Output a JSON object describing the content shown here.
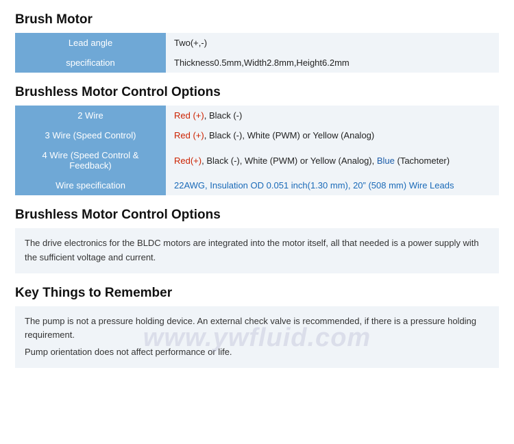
{
  "page": {
    "watermark": "www.ywfluid.com",
    "sections": [
      {
        "id": "brush-motor",
        "title": "Brush Motor",
        "type": "table",
        "rows": [
          {
            "label": "Lead angle",
            "value_parts": [
              {
                "text": "Two(+,-)",
                "color": "default"
              }
            ]
          },
          {
            "label": "specification",
            "value_parts": [
              {
                "text": "Thickness0.5mm,Width2.8mm,Height6.2mm",
                "color": "default"
              }
            ]
          }
        ]
      },
      {
        "id": "brushless-control-options",
        "title": "Brushless Motor Control Options",
        "type": "table",
        "rows": [
          {
            "label": "2 Wire",
            "value_parts": [
              {
                "text": "Red (+)",
                "color": "red"
              },
              {
                "text": ", ",
                "color": "default"
              },
              {
                "text": "Black (-)",
                "color": "black"
              }
            ]
          },
          {
            "label": "3 Wire (Speed Control)",
            "value_parts": [
              {
                "text": "Red (+)",
                "color": "red"
              },
              {
                "text": ", ",
                "color": "default"
              },
              {
                "text": "Black (-)",
                "color": "black"
              },
              {
                "text": ", White (PWM) or Yellow (Analog)",
                "color": "default"
              }
            ]
          },
          {
            "label": "4 Wire (Speed Control & Feedback)",
            "value_parts": [
              {
                "text": "Red(+)",
                "color": "red"
              },
              {
                "text": ", ",
                "color": "default"
              },
              {
                "text": "Black (-)",
                "color": "black"
              },
              {
                "text": ", White (PWM) or Yellow (Analog), ",
                "color": "default"
              },
              {
                "text": "Blue",
                "color": "blue"
              },
              {
                "text": " (Tachometer)",
                "color": "default"
              }
            ]
          },
          {
            "label": "Wire specification",
            "value_parts": [
              {
                "text": "22AWG, Insulation OD 0.051 inch(1.30 mm), 20\" (508 mm) Wire Leads",
                "color": "blue-link"
              }
            ]
          }
        ]
      },
      {
        "id": "brushless-control-desc",
        "title": "Brushless Motor Control Options",
        "type": "description",
        "text": "The drive electronics for the BLDC motors are integrated into the motor itself, all that needed is a power supply with the sufficient voltage and current."
      },
      {
        "id": "key-things",
        "title": "Key Things to Remember",
        "type": "description",
        "lines": [
          "The pump is not a pressure holding device. An external check valve is recommended, if there is a pressure holding requirement.",
          "Pump orientation does not affect performance or life."
        ]
      }
    ]
  }
}
